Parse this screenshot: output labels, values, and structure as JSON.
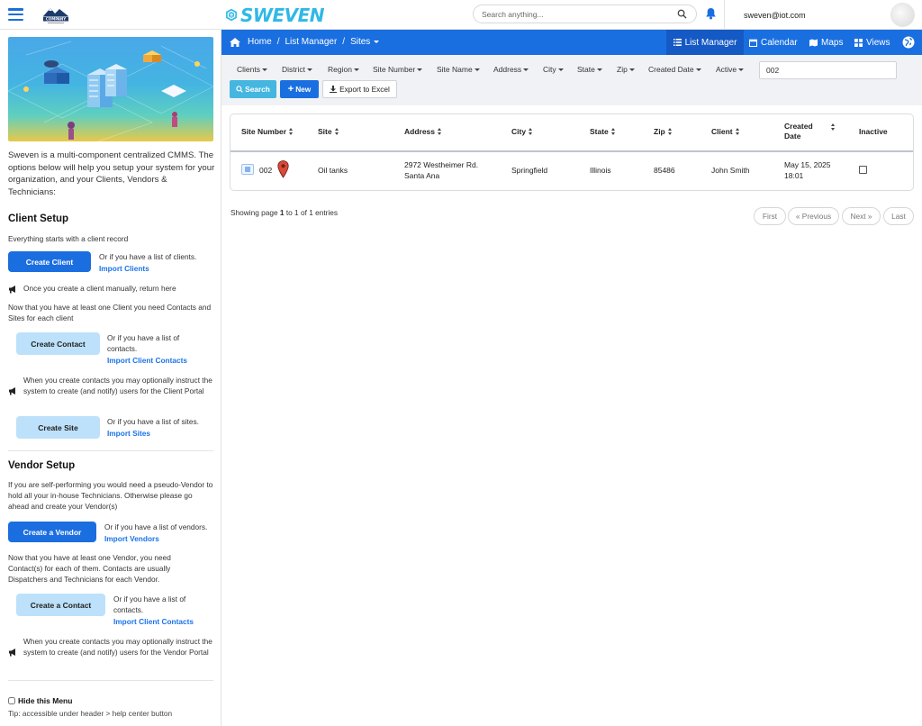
{
  "header": {
    "company_logo_text": "COMPANY",
    "brand": "SWEVEN",
    "search_placeholder": "Search anything...",
    "user_email": "sweven@iot.com"
  },
  "sidebar": {
    "intro": "Sweven is a multi-component centralized CMMS. The options below will help you setup your system for your organization, and your Clients, Vendors & Technicians:",
    "client_setup": {
      "title": "Client Setup",
      "starts": "Everything starts with a client record",
      "create_client": "Create Client",
      "clients_list_text": "Or if you have a list of clients.",
      "import_clients": "Import Clients",
      "return_note": "Once you create a client manually, return here",
      "contacts_sites_note": "Now that you have at least one Client you need Contacts and Sites for  each client",
      "create_contact": "Create Contact",
      "contacts_list_text": "Or if you have a list of contacts.",
      "import_client_contacts": "Import Client Contacts",
      "portal_note": "When you create contacts you may optionally instruct the system to create (and notify) users for the Client Portal",
      "create_site": "Create Site",
      "sites_list_text": "Or if you have a list of sites.",
      "import_sites": "Import Sites"
    },
    "vendor_setup": {
      "title": "Vendor Setup",
      "pseudo_note": "If you are self-performing you would need a pseudo-Vendor to hold all your in-house Technicians. Otherwise please go ahead and create your Vendor(s)",
      "create_vendor": "Create a Vendor",
      "vendors_list_text": "Or if you have a list of vendors.",
      "import_vendors": "Import Vendors",
      "contacts_note": "Now that you have at least one Vendor, you need Contact(s) for each of them. Contacts are usually Dispatchers and Technicians for each Vendor.",
      "create_contact": "Create a Contact",
      "contacts_list_text": "Or if you have a list of contacts.",
      "import_client_contacts": "Import Client Contacts",
      "portal_note": "When you create contacts you may optionally instruct the system to create (and notify) users for the Vendor Portal"
    },
    "hide_menu": "Hide this Menu",
    "tip": "Tip: accessible under header > help center button"
  },
  "nav": {
    "breadcrumb": [
      "Home",
      "List Manager",
      "Sites"
    ],
    "list_manager": "List Manager",
    "calendar": "Calendar",
    "maps": "Maps",
    "views": "Views"
  },
  "filters": {
    "items": [
      "Clients",
      "District",
      "Region",
      "Site Number",
      "Site Name",
      "Address",
      "City",
      "State",
      "Zip",
      "Created Date",
      "Active"
    ],
    "search_value": "002",
    "search_button": "Search",
    "new_button": "New",
    "export_button": "Export to Excel"
  },
  "table": {
    "headers": [
      "Site Number",
      "Site",
      "Address",
      "City",
      "State",
      "Zip",
      "Client",
      "Created Date",
      "Inactive"
    ],
    "row": {
      "site_number": "002",
      "site": "Oil tanks",
      "address_line1": "2972 Westheimer Rd.",
      "address_line2": "Santa Ana",
      "city": "Springfield",
      "state": "Illinois",
      "zip": "85486",
      "client": "John Smith",
      "created_line1": "May 15, 2025",
      "created_line2": "18:01",
      "inactive": false
    }
  },
  "pagination": {
    "showing_prefix": "Showing page ",
    "page": "1",
    "of_text": " to 1 of 1 entries",
    "first": "First",
    "previous": "« Previous",
    "next": "Next »",
    "last": "Last"
  },
  "colors": {
    "primary": "#1a6fe0",
    "light_button": "#bde1fa",
    "search_button": "#44b6e0",
    "link": "#1a73e8"
  }
}
